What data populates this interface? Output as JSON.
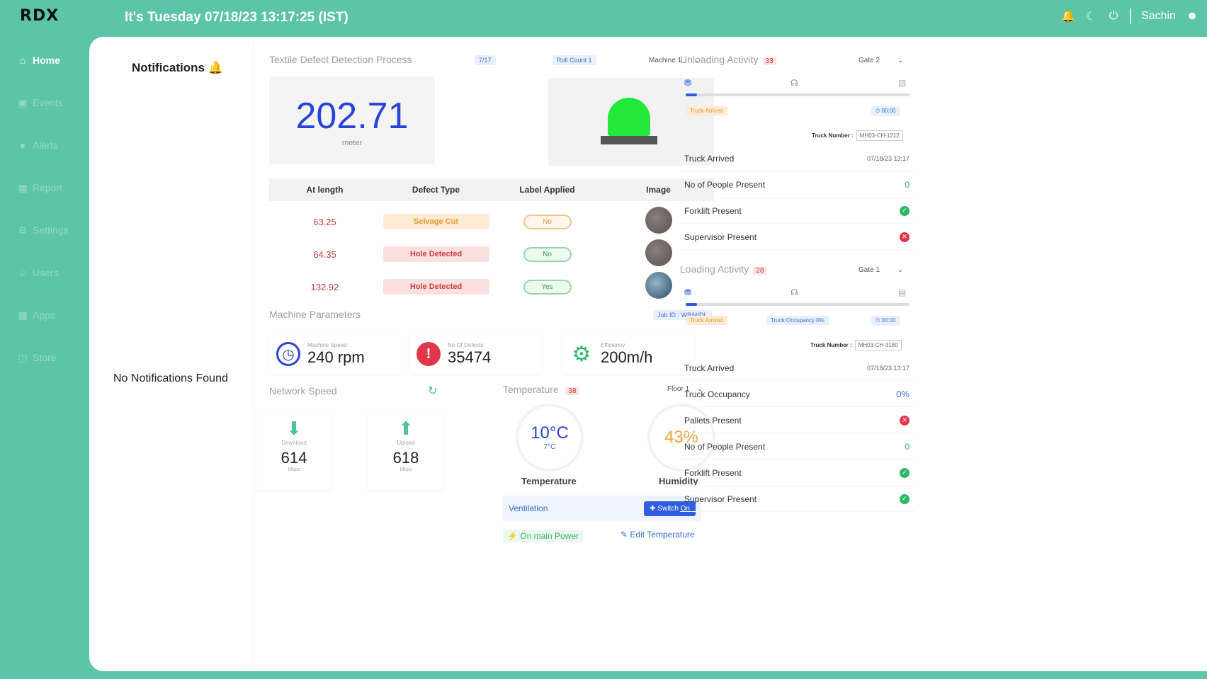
{
  "header": {
    "logo": "RDX",
    "datetime": "It's Tuesday 07/18/23 13:17:25 (IST)",
    "user": "Sachin"
  },
  "sidebar": {
    "items": [
      {
        "label": "Home",
        "icon": "home-icon"
      },
      {
        "label": "Events",
        "icon": "monitor-icon"
      },
      {
        "label": "Alerts",
        "icon": "alert-icon"
      },
      {
        "label": "Report",
        "icon": "report-icon"
      },
      {
        "label": "Settings",
        "icon": "gear-icon"
      },
      {
        "label": "Users",
        "icon": "users-icon"
      },
      {
        "label": "Apps",
        "icon": "apps-icon"
      },
      {
        "label": "Store",
        "icon": "store-icon"
      }
    ]
  },
  "notifications": {
    "title": "Notifications",
    "empty": "No Notifications Found"
  },
  "textile": {
    "title": "Textile Defect Detection Process",
    "chip1": "7/17",
    "chip2": "Roll Count 1",
    "machine_select": "Machine 1",
    "meter_value": "202.71",
    "meter_unit": "meter",
    "table": {
      "headers": [
        "At length",
        "Defect Type",
        "Label Applied",
        "Image"
      ],
      "rows": [
        {
          "length": "63.25",
          "defect": "Selvage Cut",
          "label": "No",
          "defect_color": "orange",
          "label_color": "orange"
        },
        {
          "length": "64.35",
          "defect": "Hole Detected",
          "label": "No",
          "defect_color": "red",
          "label_color": "green"
        },
        {
          "length": "132.92",
          "defect": "Hole Detected",
          "label": "Yes",
          "defect_color": "red",
          "label_color": "green"
        }
      ]
    }
  },
  "machine": {
    "title": "Machine Parameters",
    "chip": "Job ID : WB/WDL",
    "params": [
      {
        "label": "Machine Speed",
        "value": "240 rpm"
      },
      {
        "label": "No Of Defects",
        "value": "35474"
      },
      {
        "label": "Efficiency",
        "value": "200m/h"
      }
    ]
  },
  "network": {
    "title": "Network Speed",
    "download_label": "Download",
    "download_value": "614",
    "download_unit": "Mbps",
    "upload_label": "Upload",
    "upload_value": "618",
    "upload_unit": "Mbps"
  },
  "temperature": {
    "title": "Temperature",
    "badge": "38",
    "floor_select": "Floor 1",
    "temp_value": "10°C",
    "temp_sub": "7°C",
    "humidity_value": "43%",
    "temp_caption": "Temperature",
    "humidity_caption": "Humidity",
    "vent_label": "Ventilation",
    "vent_button": "Switch On",
    "mains": "On main Power",
    "edit": "Edit Temperature"
  },
  "unloading": {
    "title": "Unloading Activity",
    "badge": "33",
    "gate_select": "Gate 2",
    "tag1": "Truck Arrived",
    "timer": "00:00",
    "truck_number_label": "Truck Number :",
    "truck_number_value": "MH03-CH-1212",
    "rows": [
      {
        "label": "Truck Arrived",
        "value": "07/18/23 13:17",
        "kind": "text"
      },
      {
        "label": "No of People Present",
        "value": "0",
        "kind": "num"
      },
      {
        "label": "Forklift Present",
        "value": "ok",
        "kind": "dot"
      },
      {
        "label": "Supervisor Present",
        "value": "no",
        "kind": "dot"
      }
    ]
  },
  "loading": {
    "title": "Loading Activity",
    "badge": "28",
    "gate_select": "Gate 1",
    "tag1": "Truck Arrived",
    "tag2": "Truck Occupancy 0%",
    "timer": "00:00",
    "truck_number_label": "Truck Number :",
    "truck_number_value": "MH03-CH-3180",
    "rows": [
      {
        "label": "Truck Arrived",
        "value": "07/18/23 13:17",
        "kind": "text"
      },
      {
        "label": "Truck Occupancy",
        "value": "0%",
        "kind": "pct"
      },
      {
        "label": "Pallets Present",
        "value": "no",
        "kind": "dot"
      },
      {
        "label": "No of People Present",
        "value": "0",
        "kind": "num"
      },
      {
        "label": "Forklift Present",
        "value": "ok",
        "kind": "dot"
      },
      {
        "label": "Supervisor Present",
        "value": "ok",
        "kind": "dot"
      }
    ]
  }
}
